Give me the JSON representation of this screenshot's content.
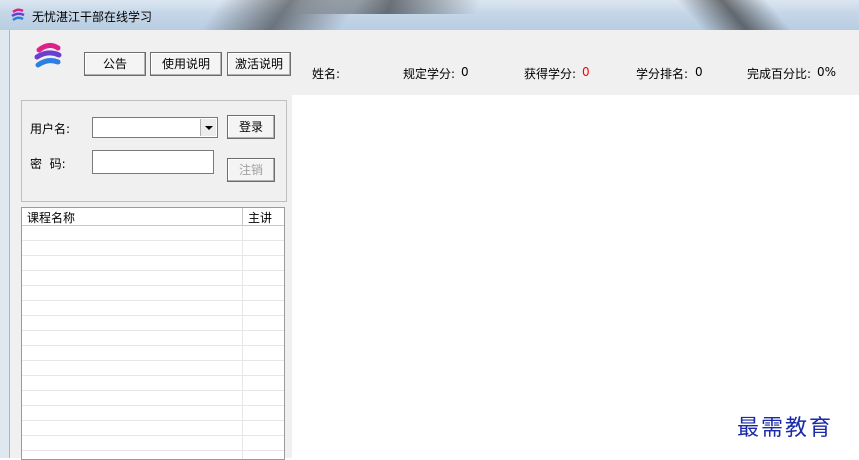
{
  "window": {
    "title": "无忧湛江干部在线学习",
    "app_icon": "app-logo-icon"
  },
  "toolbar": {
    "announcement_label": "公告",
    "usage_label": "使用说明",
    "activation_label": "激活说明"
  },
  "info": {
    "name_label": "姓名:",
    "required_credits_label": "规定学分:",
    "required_credits_value": "0",
    "earned_credits_label": "获得学分:",
    "earned_credits_value": "0",
    "earned_color": "#ff0000",
    "rank_label": "学分排名:",
    "rank_value": "0",
    "percent_label": "完成百分比:",
    "percent_value": "0%"
  },
  "login": {
    "username_label": "用户名:",
    "username_value": "",
    "password_label": "密  码:",
    "password_value": "",
    "login_label": "登录",
    "logout_label": "注销"
  },
  "courses": {
    "columns": [
      "课程名称",
      "主讲"
    ],
    "rows": []
  },
  "watermark": "最需教育"
}
